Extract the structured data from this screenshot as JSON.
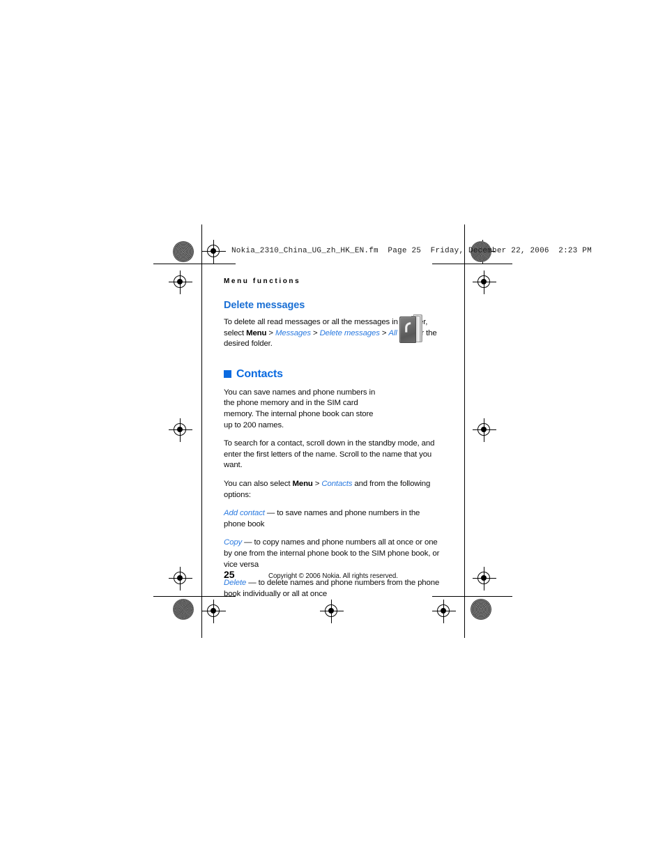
{
  "slug": {
    "text": "Nokia_2310_China_UG_zh_HK_EN.fm  Page 25  Friday, December 22, 2006  2:23 PM"
  },
  "page": {
    "running_header": "Menu functions",
    "number": "25",
    "copyright": "Copyright © 2006 Nokia. All rights reserved."
  },
  "colors": {
    "heading_blue": "#1a6fd4",
    "chapter_blue": "#0a6ae0",
    "xref_blue": "#2a7ae0",
    "body_black": "#0d0d0d"
  },
  "sections": {
    "delete_messages": {
      "heading": "Delete messages",
      "paragraph": {
        "lead": "To delete all read messages or all the messages in a folder, select ",
        "menu": "Menu",
        "sep1": " > ",
        "xref1": "Messages",
        "sep2": " > ",
        "xref2": "Delete messages",
        "sep3": " > ",
        "xref3": "All read",
        "tail": " or the desired folder."
      }
    },
    "contacts": {
      "heading": "Contacts",
      "icon_name": "phonebook-icon",
      "intro": "You can save names and phone numbers in the phone memory and in the SIM card memory. The internal phone book can store up to 200 names.",
      "search": "To search for a contact, scroll down in the standby mode, and enter the first letters of the name. Scroll to the name that you want.",
      "select_line": {
        "lead": "You can also select ",
        "menu": "Menu",
        "sep": " > ",
        "xref": "Contacts",
        "tail": " and from the following options:"
      },
      "options": [
        {
          "term": "Add contact",
          "dash": " — ",
          "description": "to save names and phone numbers in the phone book"
        },
        {
          "term": "Copy",
          "dash": " — ",
          "description": "to copy names and phone numbers all at once or one by one from the internal phone book to the SIM phone book, or vice versa"
        },
        {
          "term": "Delete",
          "dash": " — ",
          "description": "to delete names and phone numbers from the phone book individually or all at once"
        }
      ]
    }
  }
}
